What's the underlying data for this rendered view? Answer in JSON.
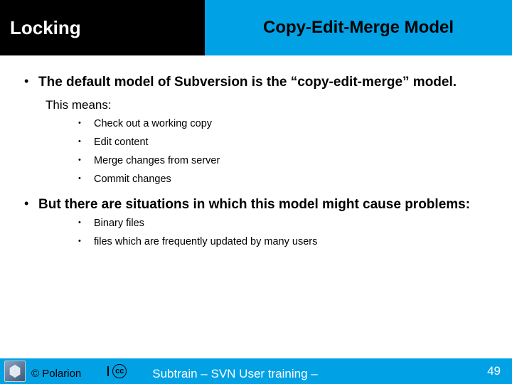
{
  "header": {
    "left": "Locking",
    "right": "Copy-Edit-Merge Model"
  },
  "content": {
    "b1": "The default model of Subversion is the “copy-edit-merge” model.",
    "b1_sub": "This means:",
    "b1_items": {
      "i0": "Check out a working copy",
      "i1": "Edit content",
      "i2": "Merge changes from server",
      "i3": "Commit changes"
    },
    "b2": "But there are situations in which this model might cause problems:",
    "b2_items": {
      "i0": "Binary files",
      "i1": "files which are frequently updated by many users"
    }
  },
  "footer": {
    "copyright": "© Polarion",
    "cc": "cc",
    "subtrain": "Subtrain – SVN User training –",
    "page": "49"
  }
}
